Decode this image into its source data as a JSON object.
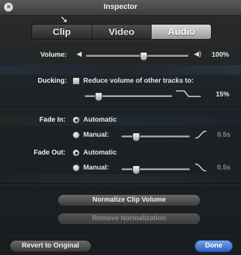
{
  "window": {
    "title": "Inspector"
  },
  "tabs": [
    {
      "label": "Clip",
      "active": false
    },
    {
      "label": "Video",
      "active": false
    },
    {
      "label": "Audio",
      "active": true
    }
  ],
  "volume": {
    "label": "Volume:",
    "value_text": "100%",
    "level": 0.55
  },
  "ducking": {
    "label": "Ducking:",
    "checkbox_label": "Reduce volume of other tracks to:",
    "checked": false,
    "value_text": "15%",
    "level": 0.15
  },
  "fade_in": {
    "label": "Fade In:",
    "automatic_label": "Automatic",
    "manual_label": "Manual:",
    "selected": "automatic",
    "value_text": "0.5s",
    "level": 0.2
  },
  "fade_out": {
    "label": "Fade Out:",
    "automatic_label": "Automatic",
    "manual_label": "Manual:",
    "selected": "automatic",
    "value_text": "0.5s",
    "level": 0.2
  },
  "buttons": {
    "normalize": "Normalize Clip Volume",
    "remove_normalization": "Remove Normalization",
    "revert": "Revert to Original",
    "done": "Done"
  },
  "colors": {
    "accent_blue": "#2d5fc0",
    "panel": "#1d2226"
  },
  "icons": {
    "close": "close-icon",
    "volume_low": "speaker-low-icon",
    "volume_high": "speaker-high-icon",
    "fade_in_curve": "fade-in-curve-icon",
    "fade_out_curve": "fade-out-curve-icon",
    "duck_curve": "duck-curve-icon"
  }
}
